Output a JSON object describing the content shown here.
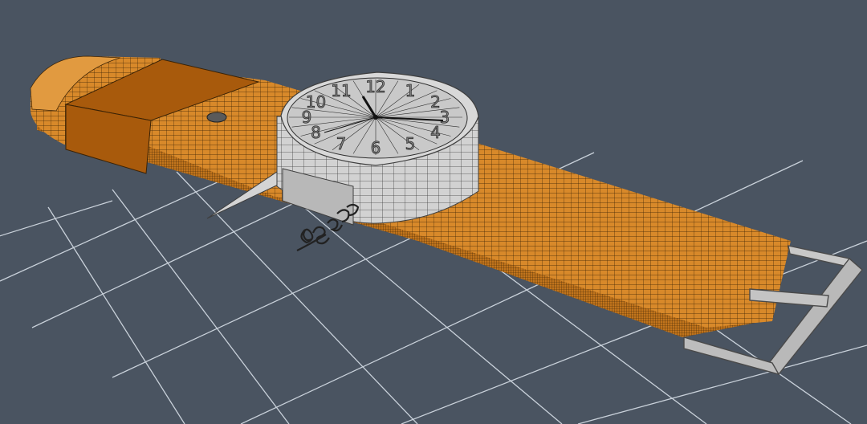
{
  "viewport": {
    "view": "perspective",
    "background_color": "#4a5461",
    "grid": {
      "visible": true,
      "color": "#c9d1da"
    }
  },
  "scene": {
    "selected_object": "wristwatch",
    "strap": {
      "fill": "#d8892a",
      "dark_fill": "#a85a0c",
      "wire_color": "#3a2205"
    },
    "watch_face": {
      "fill": "#c9c9c9",
      "case_fill": "#d2d2d2",
      "wire_color": "#2e2e2e",
      "hour_numerals": [
        "12",
        "1",
        "2",
        "3",
        "4",
        "5",
        "6",
        "7",
        "8",
        "9",
        "10",
        "11"
      ]
    },
    "buckle": {
      "fill": "#b9b9b9",
      "outline": "#4a4a4a"
    },
    "signature_icon": "script-signature"
  }
}
